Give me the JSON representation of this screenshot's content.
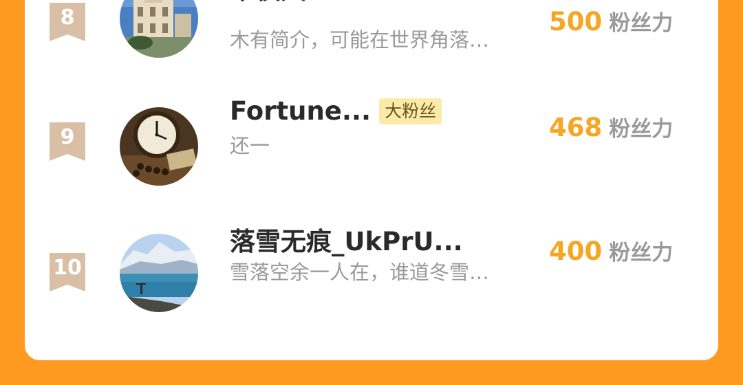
{
  "colors": {
    "background": "#FF9A20",
    "card": "#FFFFFF",
    "score_accent": "#F5A623",
    "badge": "#D9BFA5",
    "tag_bg": "#FCEBA8",
    "name_text": "#2A2A2A",
    "muted_text": "#9A9A9A"
  },
  "ranking": [
    {
      "rank": "8",
      "name": "不夜天の",
      "intro": "木有简介，可能在世界角落…",
      "score": "500",
      "unit": "粉丝力",
      "avatar_icon": "church-photo-avatar"
    },
    {
      "rank": "9",
      "name": "Fortune...",
      "tag": "大粉丝",
      "intro": "还一",
      "score": "468",
      "unit": "粉丝力",
      "avatar_icon": "clock-photo-avatar"
    },
    {
      "rank": "10",
      "name": "落雪无痕_UkPrU...",
      "intro": "雪落空余一人在，谁道冬雪…",
      "score": "400",
      "unit": "粉丝力",
      "avatar_icon": "lake-mountain-photo-avatar"
    }
  ]
}
